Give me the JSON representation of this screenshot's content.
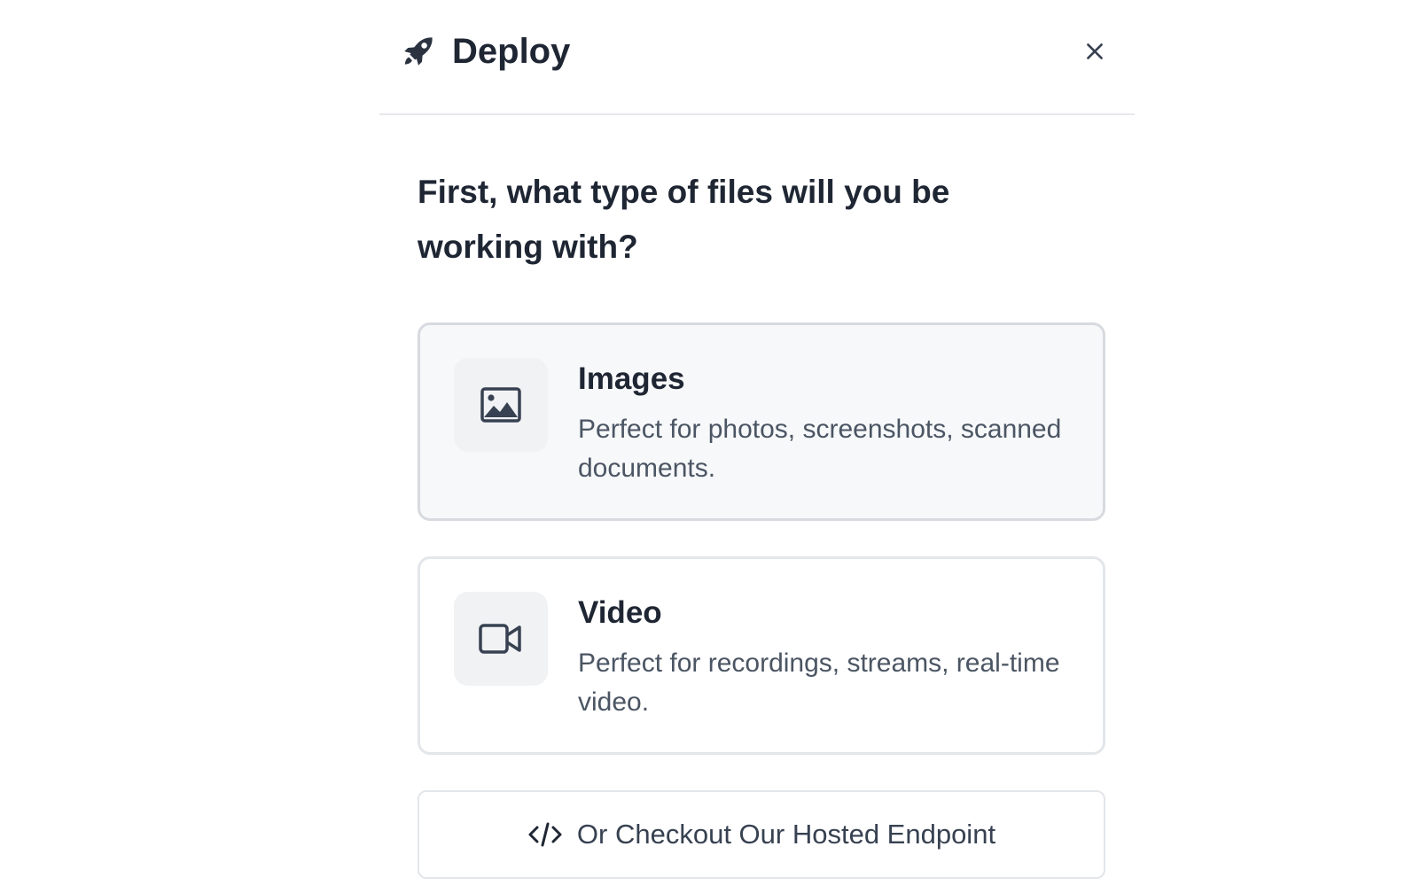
{
  "header": {
    "title": "Deploy",
    "icon": "rocket-icon",
    "close_icon": "close-icon"
  },
  "question": "First, what type of files will you be working with?",
  "options": [
    {
      "title": "Images",
      "description": "Perfect for photos, screenshots, scanned documents.",
      "icon": "image-icon",
      "selected": true
    },
    {
      "title": "Video",
      "description": "Perfect for recordings, streams, real-time video.",
      "icon": "video-icon",
      "selected": false
    }
  ],
  "hosted_button": {
    "label": "Or Checkout Our Hosted Endpoint",
    "icon": "code-icon"
  },
  "colors": {
    "text_primary": "#1f2633",
    "text_secondary": "#4b5563",
    "border": "#e3e6ea",
    "selected_bg": "#f7f8fa",
    "icon_bg": "#f1f2f4"
  }
}
